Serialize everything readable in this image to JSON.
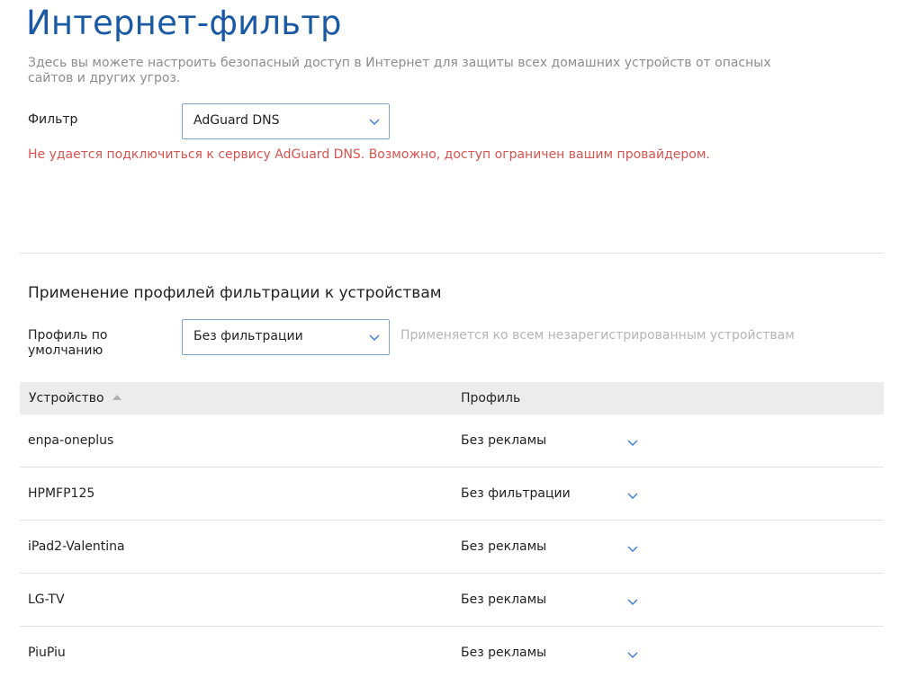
{
  "header": {
    "title": "Интернет-фильтр",
    "description": "Здесь вы можете настроить безопасный доступ в Интернет для защиты всех домашних устройств от опасных сайтов и других угроз."
  },
  "filter": {
    "label": "Фильтр",
    "value": "AdGuard DNS",
    "error": "Не удается подключиться к сервису AdGuard DNS. Возможно, доступ ограничен вашим провайдером."
  },
  "profiles": {
    "section_title": "Применение профилей фильтрации к устройствам",
    "default_label": "Профиль по умолчанию",
    "default_value": "Без фильтрации",
    "default_hint": "Применяется ко всем незарегистрированным устройствам"
  },
  "table": {
    "columns": {
      "device": "Устройство",
      "profile": "Профиль"
    },
    "rows": [
      {
        "device": "enpa-oneplus",
        "profile": "Без рекламы"
      },
      {
        "device": "HPMFP125",
        "profile": "Без фильтрации"
      },
      {
        "device": "iPad2-Valentina",
        "profile": "Без рекламы"
      },
      {
        "device": "LG-TV",
        "profile": "Без рекламы"
      },
      {
        "device": "PiuPiu",
        "profile": "Без рекламы"
      }
    ]
  },
  "colors": {
    "title": "#1a5aa5",
    "accent_border": "#7ea4d1",
    "chevron": "#3a7bd5",
    "error": "#d9534f",
    "muted_text": "#8c8c8c"
  },
  "icons": {
    "dropdown": "chevron-down-icon",
    "sort": "sort-ascending-icon"
  }
}
